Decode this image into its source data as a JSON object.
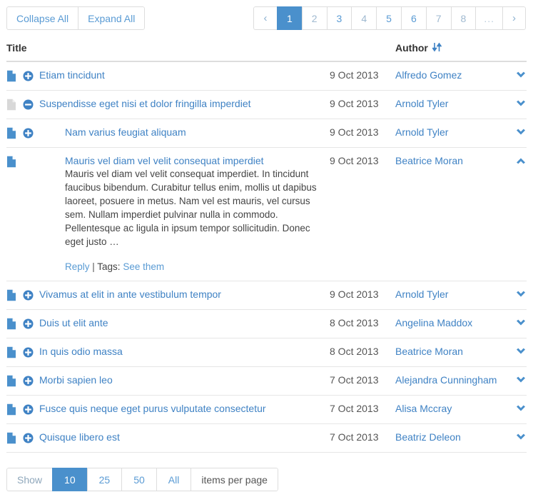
{
  "toolbar": {
    "collapse_all": "Collapse All",
    "expand_all": "Expand All"
  },
  "pagination": {
    "prev_label": "‹",
    "next_label": "›",
    "ellipsis": "...",
    "pages": [
      "1",
      "2",
      "3",
      "4",
      "5",
      "6",
      "7",
      "8"
    ],
    "active_page": "1"
  },
  "table": {
    "columns": {
      "title": "Title",
      "author": "Author",
      "sort_icon": "sort-updown-icon"
    },
    "rows": [
      {
        "title": "Etiam tincidunt",
        "date": "9 Oct 2013",
        "author": "Alfredo Gomez",
        "file_icon": "file-icon",
        "toggle_icon": "plus-circle-icon",
        "chevron": "chevron-down-icon",
        "indent": 0,
        "expanded": false,
        "muted_file": false
      },
      {
        "title": "Suspendisse eget nisi et dolor fringilla imperdiet",
        "date": "9 Oct 2013",
        "author": "Arnold Tyler",
        "file_icon": "file-icon",
        "toggle_icon": "minus-circle-icon",
        "chevron": "chevron-down-icon",
        "indent": 0,
        "expanded": false,
        "muted_file": true
      },
      {
        "title": "Nam varius feugiat aliquam",
        "date": "9 Oct 2013",
        "author": "Arnold Tyler",
        "file_icon": "file-icon",
        "toggle_icon": "plus-circle-icon",
        "chevron": "chevron-down-icon",
        "indent": 1,
        "expanded": false,
        "muted_file": false
      },
      {
        "title": "Mauris vel diam vel velit consequat imperdiet",
        "date": "9 Oct 2013",
        "author": "Beatrice Moran",
        "file_icon": "file-icon",
        "toggle_icon": "none",
        "chevron": "chevron-up-icon",
        "indent": 1,
        "expanded": true,
        "muted_file": false,
        "excerpt": "Mauris vel diam vel velit consequat imperdiet. In tincidunt faucibus bibendum. Curabitur tellus enim, mollis ut dapibus laoreet, posuere in metus. Nam vel est mauris, vel cursus sem. Nullam imperdiet pulvinar nulla in commodo. Pellentesque ac ligula in ipsum tempor sollicitudin. Donec eget justo …",
        "reply_label": "Reply",
        "tags_label": "Tags:",
        "tags_link": "See them"
      },
      {
        "title": "Vivamus at elit in ante vestibulum tempor",
        "date": "9 Oct 2013",
        "author": "Arnold Tyler",
        "file_icon": "file-icon",
        "toggle_icon": "plus-circle-icon",
        "chevron": "chevron-down-icon",
        "indent": 0,
        "expanded": false,
        "muted_file": false
      },
      {
        "title": "Duis ut elit ante",
        "date": "8 Oct 2013",
        "author": "Angelina Maddox",
        "file_icon": "file-icon",
        "toggle_icon": "plus-circle-icon",
        "chevron": "chevron-down-icon",
        "indent": 0,
        "expanded": false,
        "muted_file": false
      },
      {
        "title": "In quis odio massa",
        "date": "8 Oct 2013",
        "author": "Beatrice Moran",
        "file_icon": "file-icon",
        "toggle_icon": "plus-circle-icon",
        "chevron": "chevron-down-icon",
        "indent": 0,
        "expanded": false,
        "muted_file": false
      },
      {
        "title": "Morbi sapien leo",
        "date": "7 Oct 2013",
        "author": "Alejandra Cunningham",
        "file_icon": "file-icon",
        "toggle_icon": "plus-circle-icon",
        "chevron": "chevron-down-icon",
        "indent": 0,
        "expanded": false,
        "muted_file": false
      },
      {
        "title": "Fusce quis neque eget purus vulputate consectetur",
        "date": "7 Oct 2013",
        "author": "Alisa Mccray",
        "file_icon": "file-icon",
        "toggle_icon": "plus-circle-icon",
        "chevron": "chevron-down-icon",
        "indent": 0,
        "expanded": false,
        "muted_file": false
      },
      {
        "title": "Quisque libero est",
        "date": "7 Oct 2013",
        "author": "Beatriz Deleon",
        "file_icon": "file-icon",
        "toggle_icon": "plus-circle-icon",
        "chevron": "chevron-down-icon",
        "indent": 0,
        "expanded": false,
        "muted_file": false
      }
    ]
  },
  "page_size": {
    "show_label": "Show",
    "options": [
      "10",
      "25",
      "50",
      "All"
    ],
    "active": "10",
    "suffix_label": "items per page"
  },
  "colors": {
    "accent": "#4a90cc",
    "link": "#3f82c4",
    "muted_link": "#5a9bd4",
    "border": "#dddddd",
    "row_border": "#e6e6e6",
    "icon_muted": "#d8d8d8"
  }
}
